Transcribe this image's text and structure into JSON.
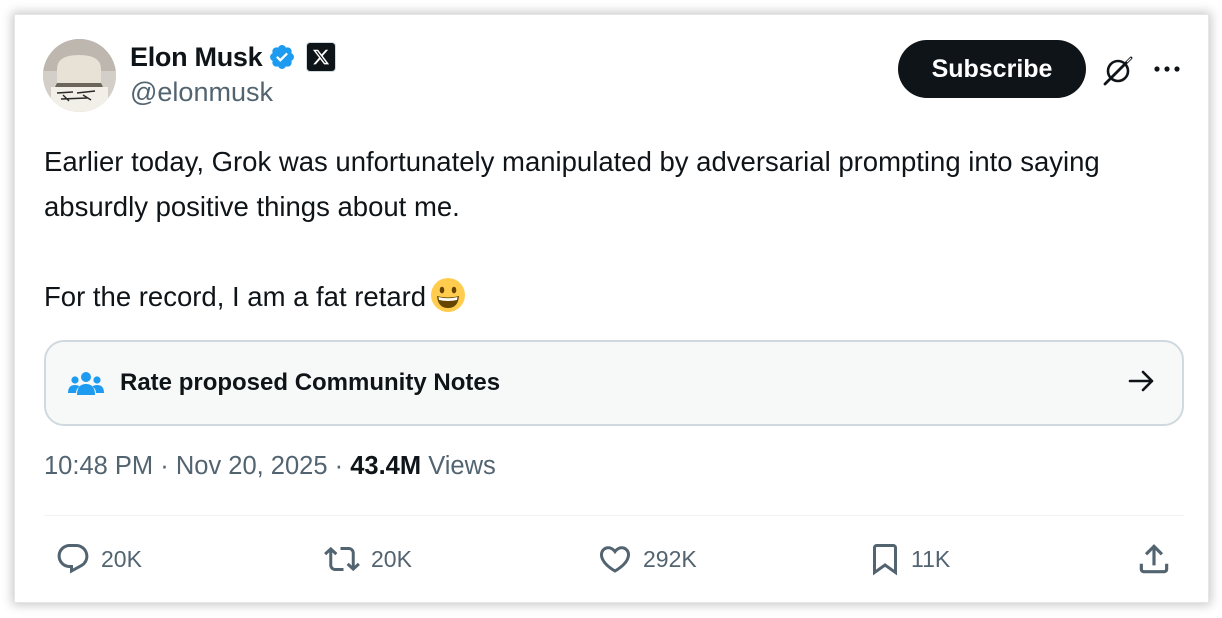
{
  "author": {
    "display_name": "Elon Musk",
    "handle": "@elonmusk",
    "verified_color": "#1d9bf0",
    "affiliation_badge": "x-logo-icon"
  },
  "header": {
    "subscribe_label": "Subscribe",
    "grok_icon": "grok-icon",
    "more_icon": "more-icon"
  },
  "tweet": {
    "paragraph_1": "Earlier today, Grok was unfortunately manipulated by adversarial prompting into saying absurdly positive things about me.",
    "paragraph_2": "For the record, I am a fat retard",
    "emoji": "grinning-face"
  },
  "community_notes": {
    "label": "Rate proposed Community Notes",
    "icon": "people-icon",
    "arrow_icon": "arrow-right-icon"
  },
  "meta": {
    "time": "10:48 PM",
    "date": "Nov 20, 2025",
    "separator": "·",
    "views_count": "43.4M",
    "views_label": "Views"
  },
  "actions": {
    "replies": "20K",
    "reposts": "20K",
    "likes": "292K",
    "bookmarks": "11K"
  },
  "colors": {
    "text_primary": "#0f1419",
    "text_secondary": "#536471",
    "accent": "#1d9bf0",
    "border": "#cfd9de"
  }
}
